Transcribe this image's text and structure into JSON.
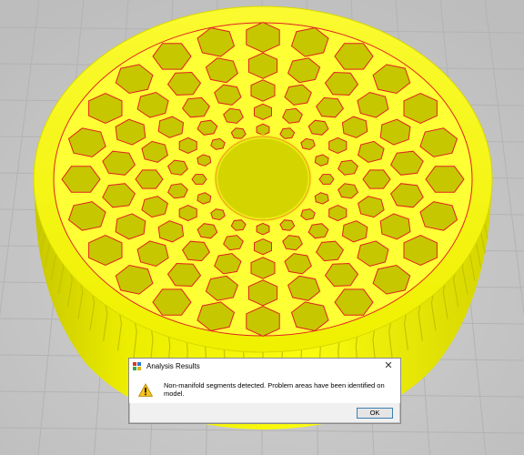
{
  "dialog": {
    "title": "Analysis Results",
    "message": "Non-manifold segments detected.  Problem areas have been identified on model.",
    "ok_label": "OK",
    "close_glyph": "✕",
    "icons": {
      "app": "app-logo-icon",
      "warning": "warning-icon",
      "close": "close-icon"
    }
  },
  "colors": {
    "model_fill": "#f4f400",
    "model_edge": "#e02020",
    "background": "#c9c9c9",
    "grid": "#b8b8b8"
  }
}
